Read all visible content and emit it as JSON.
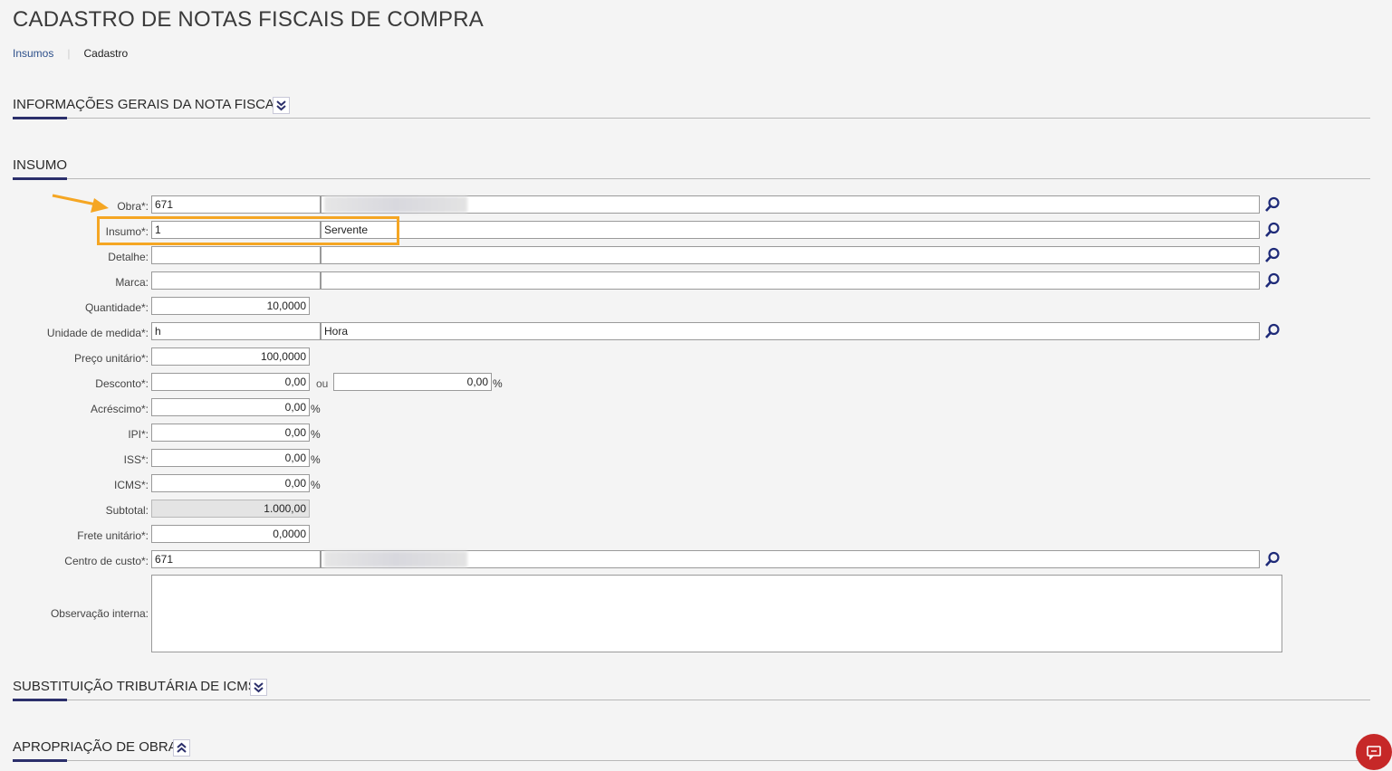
{
  "page": {
    "title": "CADASTRO DE NOTAS FISCAIS DE COMPRA"
  },
  "breadcrumb": {
    "link": "Insumos",
    "current": "Cadastro"
  },
  "sections": {
    "general": "INFORMAÇÕES GERAIS DA NOTA FISCAL",
    "insumo": "INSUMO",
    "substituicao": "SUBSTITUIÇÃO TRIBUTÁRIA DE ICMS",
    "apropriacao": "APROPRIAÇÃO DE OBRA"
  },
  "form": {
    "obra": {
      "label": "Obra*:",
      "code": "671"
    },
    "insumo": {
      "label": "Insumo*:",
      "code": "1",
      "desc": "Servente"
    },
    "detalhe": {
      "label": "Detalhe:",
      "code": "",
      "desc": ""
    },
    "marca": {
      "label": "Marca:",
      "code": "",
      "desc": ""
    },
    "quantidade": {
      "label": "Quantidade*:",
      "value": "10,0000"
    },
    "unidade": {
      "label": "Unidade de medida*:",
      "code": "h",
      "desc": "Hora"
    },
    "preco": {
      "label": "Preço unitário*:",
      "value": "100,0000"
    },
    "desconto": {
      "label": "Desconto*:",
      "value": "0,00",
      "ou": "ou",
      "percent": "0,00",
      "suffix": "%"
    },
    "acrescimo": {
      "label": "Acréscimo*:",
      "value": "0,00",
      "suffix": "%"
    },
    "ipi": {
      "label": "IPI*:",
      "value": "0,00",
      "suffix": "%"
    },
    "iss": {
      "label": "ISS*:",
      "value": "0,00",
      "suffix": "%"
    },
    "icms": {
      "label": "ICMS*:",
      "value": "0,00",
      "suffix": "%"
    },
    "subtotal": {
      "label": "Subtotal:",
      "value": "1.000,00"
    },
    "frete": {
      "label": "Frete unitário*:",
      "value": "0,0000"
    },
    "centro": {
      "label": "Centro de custo*:",
      "code": "671"
    },
    "observacao": {
      "label": "Observação interna:",
      "value": ""
    }
  },
  "colors": {
    "accent": "#2b2f6b",
    "highlight": "#f5a623",
    "chat": "#c62828"
  },
  "icons": [
    "search-icon",
    "chevron-double-down-icon",
    "chevron-double-up-icon",
    "arrow-icon",
    "chat-icon"
  ]
}
